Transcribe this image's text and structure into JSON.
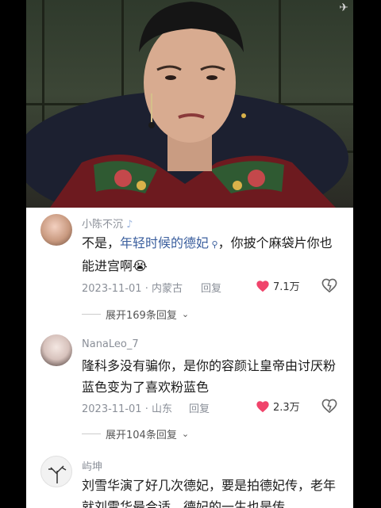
{
  "comments": [
    {
      "username": "小陈不沉",
      "text_pre": "不是，",
      "text_link": "年轻时候的德妃",
      "text_post": "，你披个麻袋片你也能进宫啊",
      "emoji": "😭",
      "date": "2023-11-01",
      "location": "内蒙古",
      "reply_label": "回复",
      "likes": "7.1万",
      "expand_label": "展开169条回复"
    },
    {
      "username": "NanaLeo_7",
      "text": "隆科多没有骗你，是你的容颜让皇帝由讨厌粉蓝色变为了喜欢粉蓝色",
      "date": "2023-11-01",
      "location": "山东",
      "reply_label": "回复",
      "likes": "2.3万",
      "expand_label": "展开104条回复"
    },
    {
      "username": "屿坤",
      "text": "刘雪华演了好几次德妃，要是拍德妃传，老年就刘雪华最合适，德妃的一生也是传"
    }
  ],
  "colors": {
    "like_heart": "#f0446b",
    "link": "#3b5f9e",
    "meta": "#8a8f98"
  }
}
